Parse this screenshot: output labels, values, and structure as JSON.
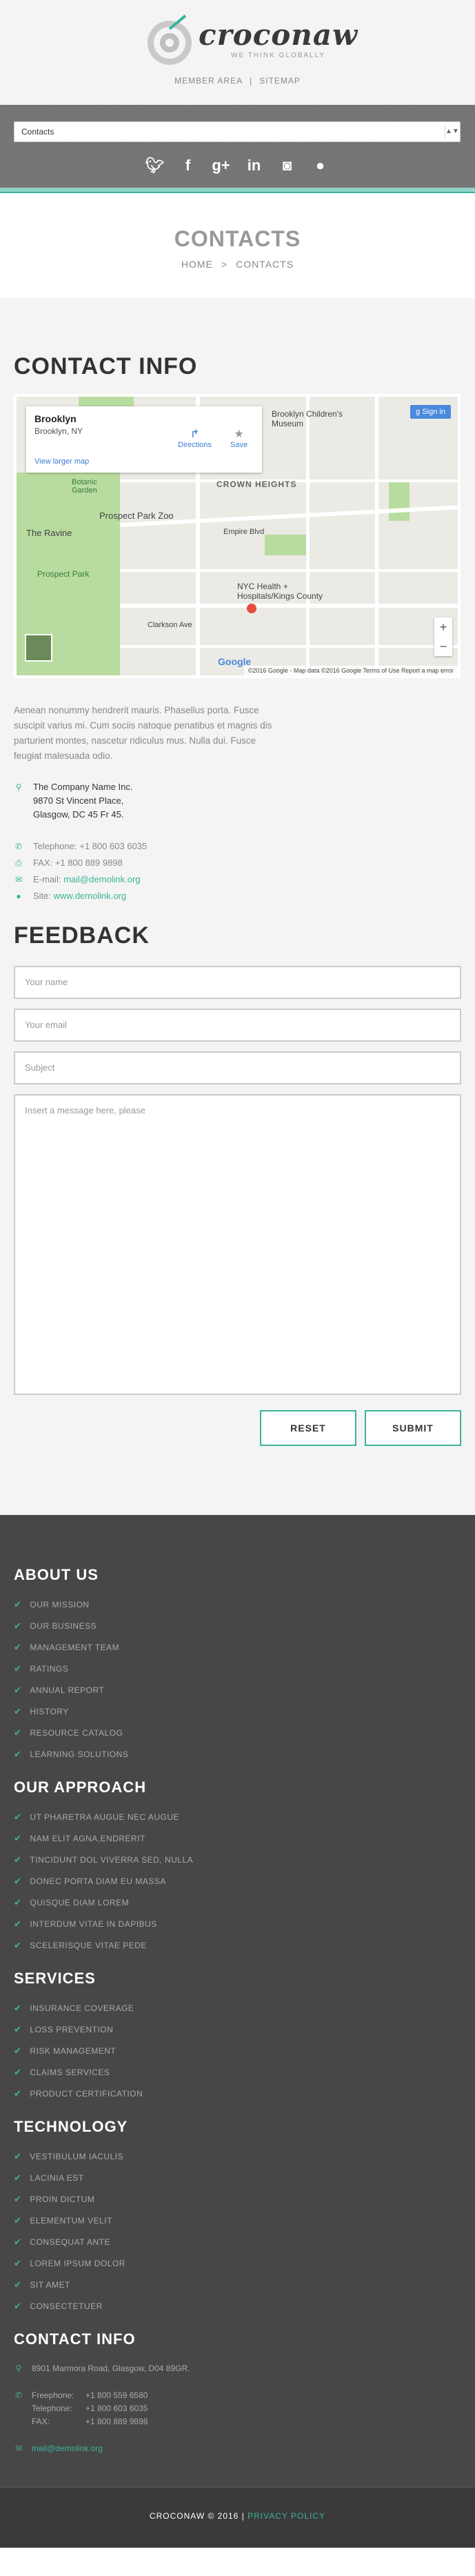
{
  "header": {
    "logo_name": "croconaw",
    "logo_tagline": "WE THINK GLOBALLY",
    "links": [
      "MEMBER AREA",
      "SITEMAP"
    ],
    "link_separator": "|"
  },
  "nav": {
    "select_value": "Contacts",
    "social_icons": [
      "twitter-icon",
      "facebook-icon",
      "google-plus-icon",
      "linkedin-icon",
      "instagram-icon",
      "github-icon"
    ]
  },
  "page_title": {
    "title": "CONTACTS",
    "breadcrumb": [
      "HOME",
      "CONTACTS"
    ],
    "separator": ">"
  },
  "contact_info": {
    "heading": "CONTACT INFO",
    "map": {
      "place": "Brooklyn",
      "region": "Brooklyn, NY",
      "larger_map": "View larger map",
      "directions": "Directions",
      "save": "Save",
      "sign_in": "Sign in",
      "labels": [
        "Brooklyn Children's Museum",
        "CROWN HEIGHTS",
        "Prospect Park Zoo",
        "NYC Health + Hospitals/Kings County",
        "The Ravine",
        "Prospect Park",
        "Clarkson Ave",
        "Empire Blvd",
        "Botanic Garden"
      ],
      "footer": "©2016 Google - Map data ©2016 Google   Terms of Use   Report a map error",
      "google": "Google"
    },
    "text": "Aenean nonummy hendrerit mauris. Phasellus porta. Fusce suscipit varius mi. Cum sociis natoque penatibus et magnis dis parturient montes, nascetur ridiculus mus. Nulla dui. Fusce feugiat malesuada odio.",
    "address": [
      "The Company Name Inc.",
      "9870 St Vincent Place,",
      "Glasgow, DC 45 Fr 45."
    ],
    "telephone_label": "Telephone:",
    "telephone": "+1 800 603 6035",
    "fax_label": "FAX:",
    "fax": "+1 800 889 9898",
    "email_label": "E-mail:",
    "email": "mail@demolink.org",
    "site_label": "Site:",
    "site": "www.demolink.org"
  },
  "feedback": {
    "heading": "FEEDBACK",
    "name_placeholder": "Your name",
    "email_placeholder": "Your email",
    "subject_placeholder": "Subject",
    "message_placeholder": "Insert a message here, please",
    "reset": "RESET",
    "submit": "SUBMIT"
  },
  "footer": {
    "about_heading": "ABOUT US",
    "about_items": [
      "OUR MISSION",
      "OUR BUSINESS",
      "MANAGEMENT TEAM",
      "RATINGS",
      "ANNUAL REPORT",
      "HISTORY",
      "RESOURCE CATALOG",
      "LEARNING SOLUTIONS"
    ],
    "approach_heading": "OUR APPROACH",
    "approach_items": [
      "UT PHARETRA AUGUE NEC AUGUE",
      "NAM ELIT AGNA,ENDRERIT",
      "TINCIDUNT DOL VIVERRA SED, NULLA",
      "DONEC PORTA DIAM EU MASSA",
      "QUISQUE DIAM LOREM",
      "INTERDUM VITAE IN DAPIBUS",
      "SCELERISQUE VITAE PEDE"
    ],
    "services_heading": "SERVICES",
    "services_items": [
      "INSURANCE COVERAGE",
      "LOSS PREVENTION",
      "RISK MANAGEMENT",
      "CLAIMS SERVICES",
      "PRODUCT CERTIFICATION"
    ],
    "technology_heading": "TECHNOLOGY",
    "technology_items": [
      "VESTIBULUM IACULIS",
      "LACINIA EST",
      "PROIN DICTUM",
      "ELEMENTUM VELIT",
      "CONSEQUAT ANTE",
      "LOREM IPSUM DOLOR",
      "SIT AMET",
      "CONSECTETUER"
    ],
    "contact_heading": "CONTACT INFO",
    "address": "8901 Marmora Road, Glasgow, D04 89GR.",
    "freephone_label": "Freephone:",
    "freephone": "+1 800 559 6580",
    "telephone_label": "Telephone:",
    "telephone": "+1 800 603 6035",
    "fax_label": "FAX:",
    "fax": "+1 800 889 9898",
    "email": "mail@demolink.org",
    "copyright": "CROCONAW © 2016",
    "privacy": "PRIVACY POLICY"
  }
}
